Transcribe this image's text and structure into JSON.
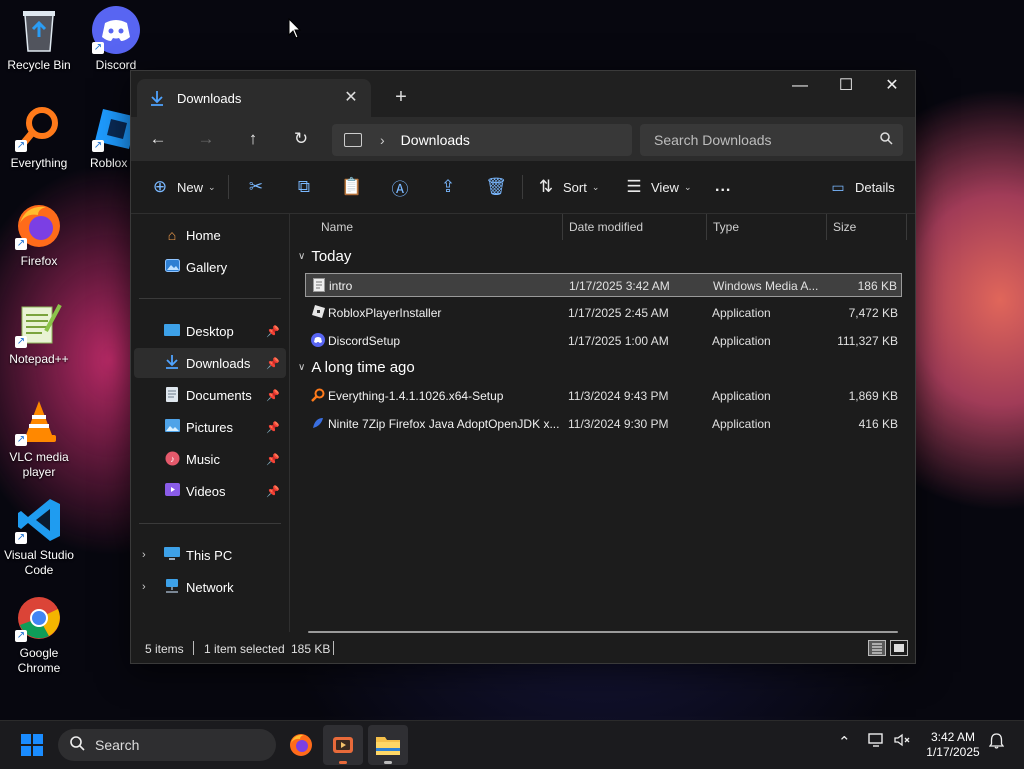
{
  "desktop": {
    "icons": [
      {
        "label": "Recycle Bin"
      },
      {
        "label": "Discord"
      },
      {
        "label": "Everything"
      },
      {
        "label": "Roblox St"
      },
      {
        "label": "Firefox"
      },
      {
        "label": "Notepad++"
      },
      {
        "label": "VLC media player"
      },
      {
        "label": "Visual Studio Code"
      },
      {
        "label": "Google Chrome"
      }
    ]
  },
  "window": {
    "tab_title": "Downloads",
    "address": {
      "current": "Downloads"
    },
    "search": {
      "placeholder": "Search Downloads"
    },
    "commands": {
      "new_label": "New",
      "sort_label": "Sort",
      "view_label": "View",
      "more_label": "...",
      "details_label": "Details"
    },
    "sidebar": {
      "items": [
        {
          "label": "Home"
        },
        {
          "label": "Gallery"
        },
        {
          "label": "Desktop"
        },
        {
          "label": "Downloads"
        },
        {
          "label": "Documents"
        },
        {
          "label": "Pictures"
        },
        {
          "label": "Music"
        },
        {
          "label": "Videos"
        },
        {
          "label": "This PC"
        },
        {
          "label": "Network"
        }
      ]
    },
    "columns": {
      "name": "Name",
      "date": "Date modified",
      "type": "Type",
      "size": "Size"
    },
    "groups": [
      {
        "label": "Today",
        "files": [
          {
            "name": "intro",
            "date": "1/17/2025 3:42 AM",
            "type": "Windows Media A...",
            "size": "186 KB",
            "selected": true
          },
          {
            "name": "RobloxPlayerInstaller",
            "date": "1/17/2025 2:45 AM",
            "type": "Application",
            "size": "7,472 KB"
          },
          {
            "name": "DiscordSetup",
            "date": "1/17/2025 1:00 AM",
            "type": "Application",
            "size": "111,327 KB"
          }
        ]
      },
      {
        "label": "A long time ago",
        "files": [
          {
            "name": "Everything-1.4.1.1026.x64-Setup",
            "date": "11/3/2024 9:43 PM",
            "type": "Application",
            "size": "1,869 KB"
          },
          {
            "name": "Ninite 7Zip Firefox Java AdoptOpenJDK x...",
            "date": "11/3/2024 9:30 PM",
            "type": "Application",
            "size": "416 KB"
          }
        ]
      }
    ],
    "status": {
      "items": "5 items",
      "selected": "1 item selected",
      "size": "185 KB"
    }
  },
  "taskbar": {
    "search_label": "Search",
    "time": "3:42 AM",
    "date": "1/17/2025"
  },
  "colors": {
    "accent": "#4fa3ff",
    "windows_blue": "#1a8cff"
  }
}
